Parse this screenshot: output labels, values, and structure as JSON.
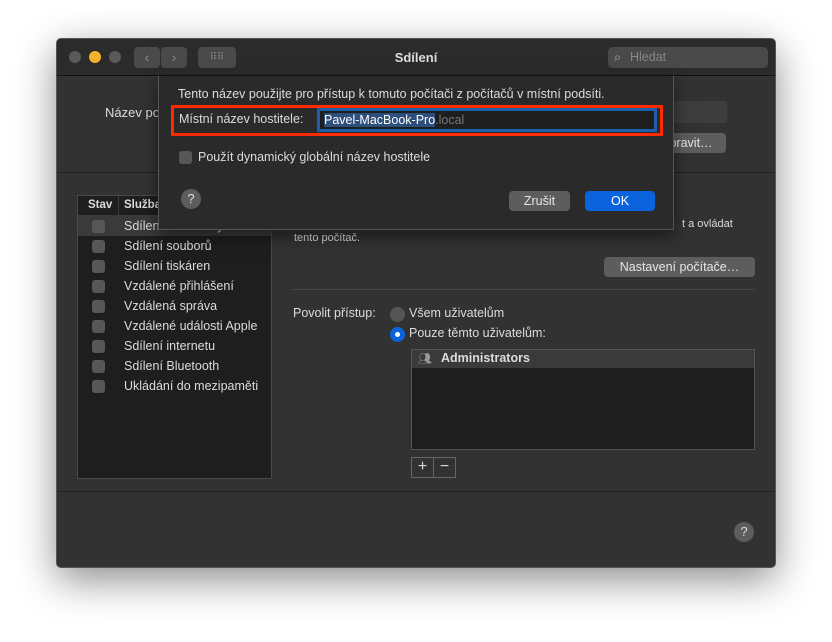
{
  "window": {
    "title": "Sdílení",
    "search_placeholder": "Hledat"
  },
  "top": {
    "computer_name_label": "Název počítače:",
    "edit_button": "Upravit…"
  },
  "services": {
    "col_status": "Stav",
    "col_service": "Služba",
    "items": [
      {
        "label": "Sdílení obrazovky",
        "checked": false
      },
      {
        "label": "Sdílení souborů",
        "checked": false
      },
      {
        "label": "Sdílení tiskáren",
        "checked": false
      },
      {
        "label": "Vzdálené přihlášení",
        "checked": false
      },
      {
        "label": "Vzdálená správa",
        "checked": false
      },
      {
        "label": "Vzdálené události Apple",
        "checked": false
      },
      {
        "label": "Sdílení internetu",
        "checked": false
      },
      {
        "label": "Sdílení Bluetooth",
        "checked": false
      },
      {
        "label": "Ukládání do mezipaměti",
        "checked": false
      }
    ]
  },
  "detail": {
    "description_tail": "t a ovládat",
    "description_line2": "tento počítač.",
    "settings_button": "Nastavení počítače…",
    "access_label": "Povolit přístup:",
    "radio_all": "Všem uživatelům",
    "radio_only": "Pouze těmto uživatelům:",
    "users": [
      "Administrators"
    ],
    "add": "+",
    "remove": "−"
  },
  "dialog": {
    "info": "Tento název použijte pro přístup k tomuto počítači z počítačů v místní podsíti.",
    "hostname_label": "Místní název hostitele:",
    "hostname_value": "Pavel-MacBook-Pro",
    "hostname_suffix": ".local",
    "dynamic_checkbox": "Použít dynamický globální název hostitele",
    "cancel": "Zrušit",
    "ok": "OK"
  },
  "help": "?",
  "colors": {
    "accent": "#0a63dc",
    "highlight_border": "#ff2a00"
  }
}
